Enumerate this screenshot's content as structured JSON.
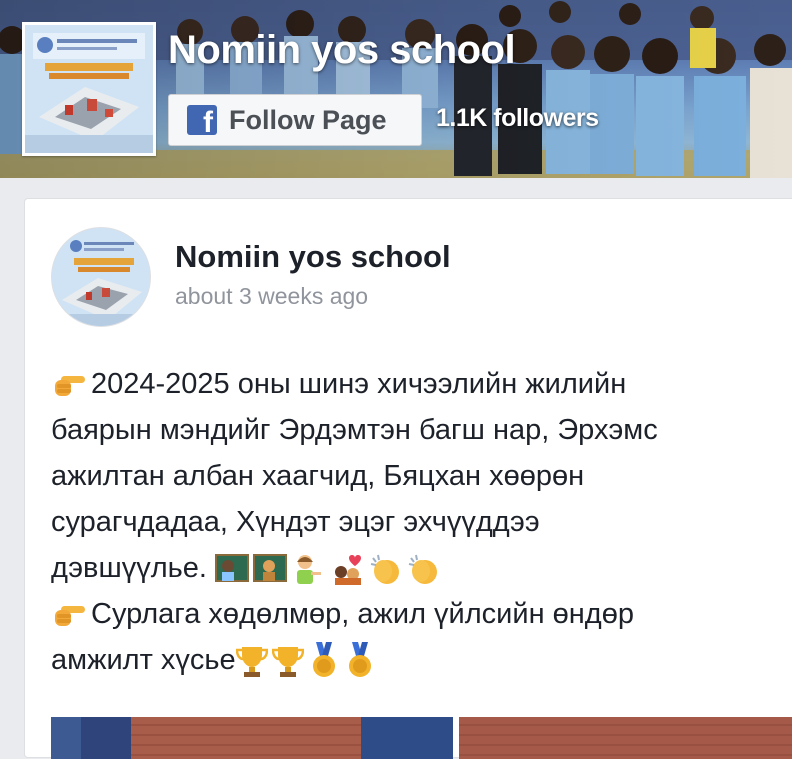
{
  "header": {
    "page_name": "Nomiin yos school",
    "follow_button_label": "Follow Page",
    "followers": "1.1K followers",
    "fb_glyph": "f"
  },
  "post": {
    "author": "Nomiin yos school",
    "timestamp": "about 3 weeks ago",
    "lines": [
      "2024-2025 оны шинэ хичээлийн жилийн",
      "баярын мэндийг Эрдэмтэн багш нар, Эрхэмс",
      "ажилтан албан хаагчид, Бяцхан хөөрөн",
      "сурагчдадаа, Хүндэт эцэг эхчүүддээ",
      "дэвшүүлье.",
      "Сурлага хөдөлмөр, ажил үйлсийн өндөр",
      "амжилт хүсье"
    ]
  },
  "icons": {
    "facebook": "facebook-logo-icon",
    "pointing": "pointing-hand-emoji",
    "teacher": "teacher-emoji",
    "clap": "clapping-hands-emoji",
    "trophy": "trophy-emoji",
    "medal": "medal-emoji"
  },
  "colors": {
    "facebook_blue": "#4267b2",
    "text": "#1d2129",
    "muted": "#90949c"
  }
}
